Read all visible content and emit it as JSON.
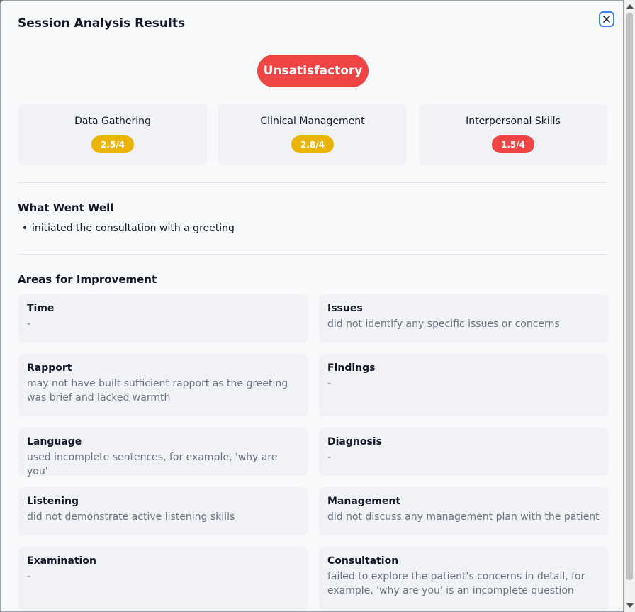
{
  "modal": {
    "title": "Session Analysis Results",
    "close_label": "×"
  },
  "verdict": {
    "label": "Unsatisfactory",
    "color": "#ef4444"
  },
  "scores": [
    {
      "name": "Data Gathering",
      "score": "2.5/4",
      "color": "#eab308"
    },
    {
      "name": "Clinical Management",
      "score": "2.8/4",
      "color": "#eab308"
    },
    {
      "name": "Interpersonal Skills",
      "score": "1.5/4",
      "color": "#ef4444"
    }
  ],
  "went_well": {
    "title": "What Went Well",
    "items": [
      "initiated the consultation with a greeting"
    ]
  },
  "improvement": {
    "title": "Areas for Improvement",
    "areas": [
      {
        "heading": "Time",
        "text": "-"
      },
      {
        "heading": "Issues",
        "text": "did not identify any specific issues or concerns"
      },
      {
        "heading": "Rapport",
        "text": "may not have built sufficient rapport as the greeting was brief and lacked warmth"
      },
      {
        "heading": "Findings",
        "text": "-"
      },
      {
        "heading": "Language",
        "text": "used incomplete sentences, for example, 'why are you'"
      },
      {
        "heading": "Diagnosis",
        "text": "-"
      },
      {
        "heading": "Listening",
        "text": "did not demonstrate active listening skills"
      },
      {
        "heading": "Management",
        "text": "did not discuss any management plan with the patient"
      },
      {
        "heading": "Examination",
        "text": "-"
      },
      {
        "heading": "Consultation",
        "text": "failed to explore the patient's concerns in detail, for example, 'why are you' is an incomplete question"
      }
    ]
  }
}
